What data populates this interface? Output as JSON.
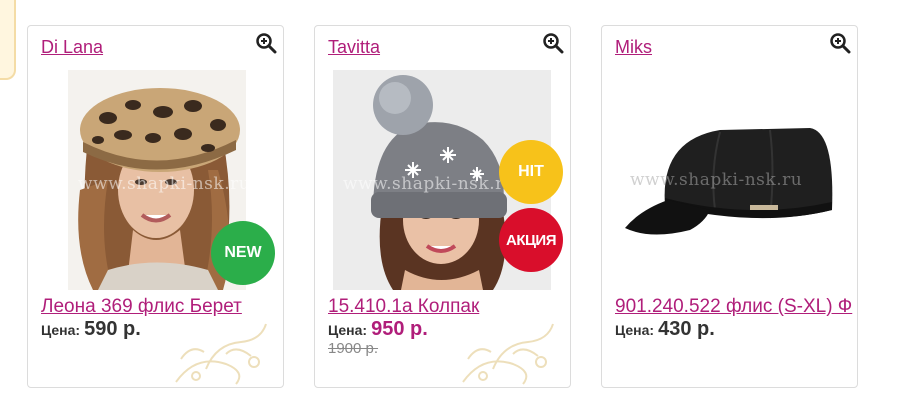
{
  "products": [
    {
      "brand": "Di Lana",
      "name": "Леона 369 флис Берет",
      "price_label": "Цена:",
      "price": "590 р.",
      "badges": [
        "NEW"
      ],
      "watermark": "www.shapki-nsk.ru"
    },
    {
      "brand": "Tavitta",
      "name": "15.410.1a Колпак",
      "price_label": "Цена:",
      "price": "950 р.",
      "old_price": "1900 р.",
      "badges": [
        "HIT",
        "АКЦИЯ"
      ],
      "watermark": "www.shapki-nsk.ru"
    },
    {
      "brand": "Miks",
      "name": "901.240.522 флис (S-XL) Ф",
      "price_label": "Цена:",
      "price": "430 р.",
      "badges": [],
      "watermark": "www.shapki-nsk.ru"
    }
  ],
  "icons": {
    "zoom": "zoom-in-icon"
  },
  "colors": {
    "accent": "#b01e7a",
    "badge_new": "#2bae4a",
    "badge_hit": "#f7c21a",
    "badge_sale": "#d90e2b"
  }
}
